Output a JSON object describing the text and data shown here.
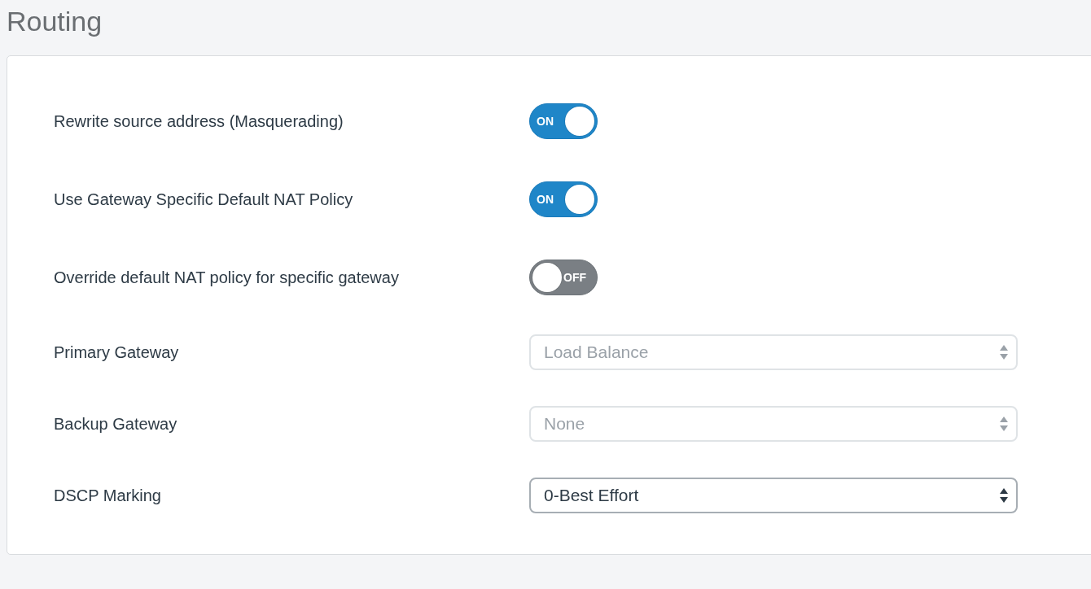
{
  "page": {
    "title": "Routing"
  },
  "settings": [
    {
      "kind": "toggle",
      "label": "Rewrite source address (Masquerading)",
      "on": true,
      "state_text": "ON"
    },
    {
      "kind": "toggle",
      "label": "Use Gateway Specific Default NAT Policy",
      "on": true,
      "state_text": "ON"
    },
    {
      "kind": "toggle",
      "label": "Override default NAT policy for specific gateway",
      "on": false,
      "state_text": "OFF"
    },
    {
      "kind": "select",
      "label": "Primary Gateway",
      "value": "Load Balance",
      "disabled": true
    },
    {
      "kind": "select",
      "label": "Backup Gateway",
      "value": "None",
      "disabled": true
    },
    {
      "kind": "select",
      "label": "DSCP Marking",
      "value": "0-Best Effort",
      "disabled": false
    }
  ]
}
